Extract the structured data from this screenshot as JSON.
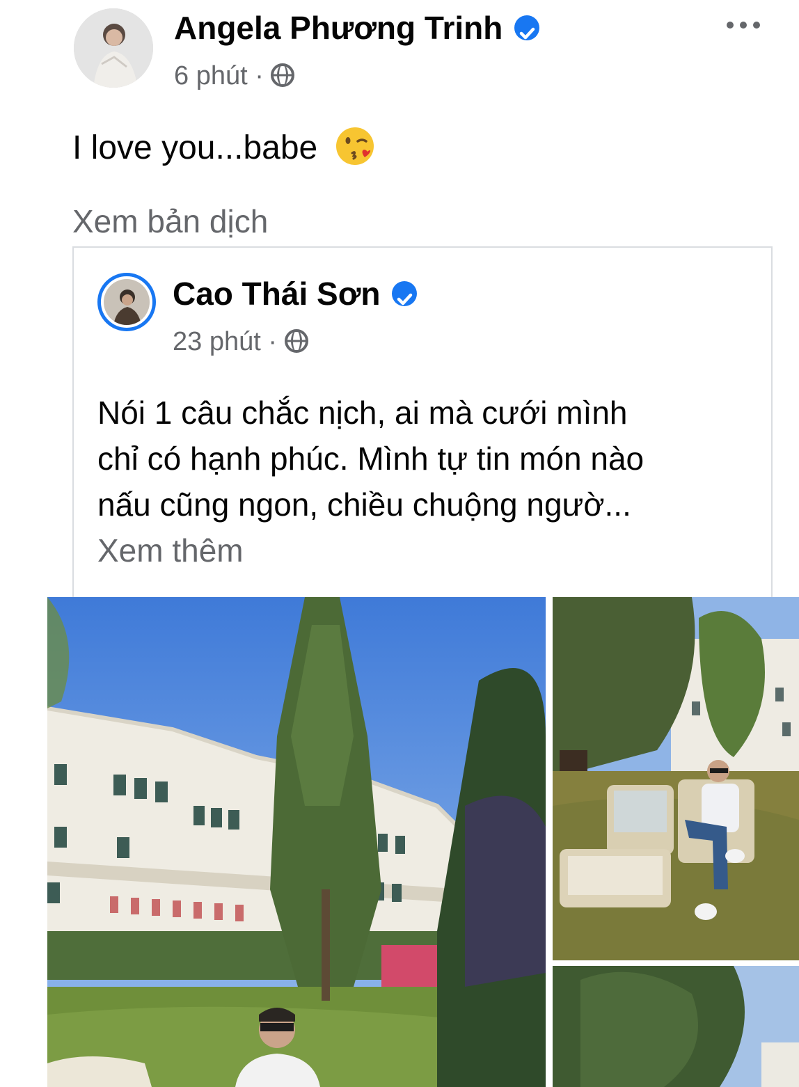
{
  "post": {
    "author": "Angela Phương Trinh",
    "time": "6 phút",
    "separator": "·",
    "text": "I love you...babe",
    "translate_link": "Xem bản dịch",
    "more_icon": "ellipsis-icon",
    "emoji": "kissing-face-with-heart-emoji"
  },
  "shared": {
    "author": "Cao Thái Sơn",
    "time": "23 phút",
    "separator": "·",
    "text_line1": "Nói 1 câu chắc nịch, ai mà cưới mình",
    "text_line2": "chỉ có hạnh phúc. Mình tự tin món nào",
    "text_line3": "nấu cũng ngon, chiều chuộng ngườ...",
    "see_more": "Xem thêm"
  },
  "colors": {
    "verified": "#1877f2",
    "meta": "#65676b",
    "sky": "#4f86e0",
    "grass": "#6f8f3a"
  }
}
